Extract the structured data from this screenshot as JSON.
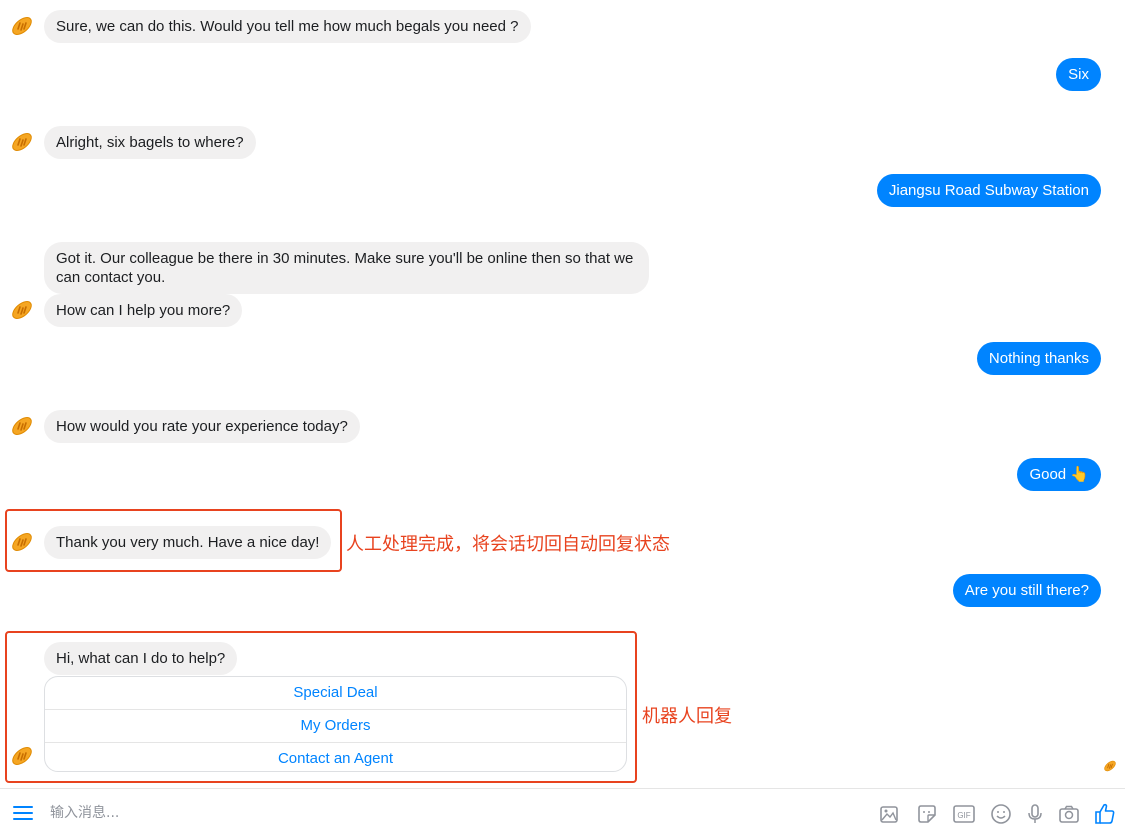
{
  "conversation": {
    "messages": [
      {
        "from": "bot",
        "text": "Sure, we can do this. Would you tell me how much begals you need ?"
      },
      {
        "from": "user",
        "text": "Six"
      },
      {
        "from": "bot",
        "text": "Alright, six bagels to where?"
      },
      {
        "from": "user",
        "text": "Jiangsu Road Subway Station"
      },
      {
        "from": "bot",
        "text": "Got it. Our colleague be there in 30 minutes. Make sure you'll be online then so that we can contact you."
      },
      {
        "from": "bot",
        "text": "How can I help you more?"
      },
      {
        "from": "user",
        "text": "Nothing thanks"
      },
      {
        "from": "bot",
        "text": "How would you rate your experience today?"
      },
      {
        "from": "user",
        "text": "Good 👆"
      },
      {
        "from": "bot",
        "text": "Thank you very much. Have a nice day!"
      },
      {
        "from": "user",
        "text": "Are you still there?"
      },
      {
        "from": "bot",
        "text": "Hi, what can I do to help?"
      }
    ],
    "quick_replies": [
      "Special Deal",
      "My Orders",
      "Contact an Agent"
    ]
  },
  "annotations": {
    "handoff_note": "人工处理完成，将会话切回自动回复状态",
    "bot_reply_note": "机器人回复"
  },
  "composer": {
    "placeholder": "输入消息...",
    "icons": [
      "menu-icon",
      "image-icon",
      "sticker-icon",
      "gif-icon",
      "emoji-icon",
      "microphone-icon",
      "camera-icon",
      "thumbs-up-icon"
    ]
  },
  "colors": {
    "accent": "#0084ff",
    "incoming_bubble": "#f1f0f0",
    "annotation": "#e8431f",
    "avatar": "#f5a623"
  }
}
